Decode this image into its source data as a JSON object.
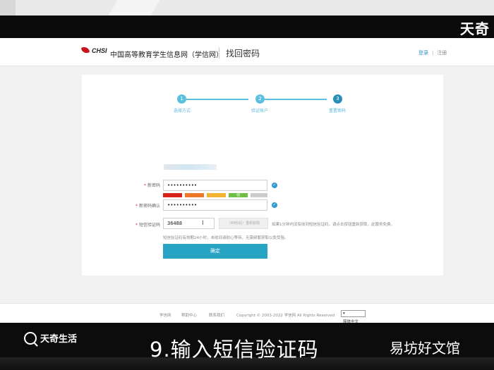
{
  "watermark_top": "天奇",
  "header": {
    "logo_text": "CHSI",
    "site_name": "中国高等教育学生信息网（学信网）",
    "page_name": "找回密码",
    "login": "登录",
    "separator": "|",
    "register": "注册"
  },
  "steps": [
    {
      "num": "1",
      "label": "选择方式"
    },
    {
      "num": "2",
      "label": "验证账户"
    },
    {
      "num": "3",
      "label": "重置密码"
    }
  ],
  "form": {
    "new_password_label": "新密码",
    "new_password_value": "••••••••••",
    "strength_label": "强",
    "confirm_label": "新密码确认",
    "confirm_value": "••••••••••",
    "sms_label": "短信验证码",
    "sms_value": "36488",
    "resend_button": "（40秒后）重新获取",
    "sms_hint": "如果1分钟内没有收到短信验证码，请点击按钮重新获取，此服务免费。",
    "validity_hint": "短信验证码有效期24小时，未收到请耐心等待，无需频繁获取以免受阻。",
    "submit": "确定",
    "required_mark": "*"
  },
  "footer": {
    "links": [
      "学信网",
      "帮助中心",
      "联系我们"
    ],
    "copyright": "Copyright © 2003-2022  学信网  All Rights Reserved",
    "language": "简体中文"
  },
  "overlay": {
    "brand_left": "天奇生活",
    "subtitle": "9.输入短信验证码",
    "brand_right": "易坊好文馆"
  },
  "colors": {
    "accent": "#27a3c4",
    "step_active": "#5bc0de",
    "step_current": "#2a8fb8"
  }
}
